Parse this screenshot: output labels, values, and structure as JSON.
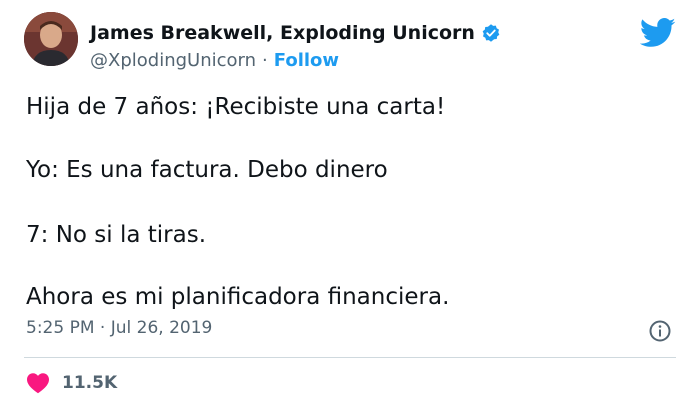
{
  "author": {
    "display_name": "James Breakwell, Exploding Unicorn",
    "handle": "@XplodingUnicorn",
    "separator": "·",
    "follow_label": "Follow"
  },
  "tweet": {
    "lines": [
      "Hija de 7 años: ¡Recibiste una carta!",
      "Yo: Es una factura. Debo dinero",
      "7: No si la tiras.",
      "Ahora es mi planificadora financiera."
    ],
    "timestamp": "5:25 PM · Jul 26, 2019"
  },
  "engagement": {
    "like_count": "11.5K"
  },
  "colors": {
    "accent": "#1d9bf0",
    "heart": "#f91880",
    "secondary_text": "#536471"
  },
  "icons": {
    "platform": "twitter-bird-icon",
    "verified": "verified-badge-icon",
    "info": "info-icon",
    "like": "heart-icon"
  }
}
